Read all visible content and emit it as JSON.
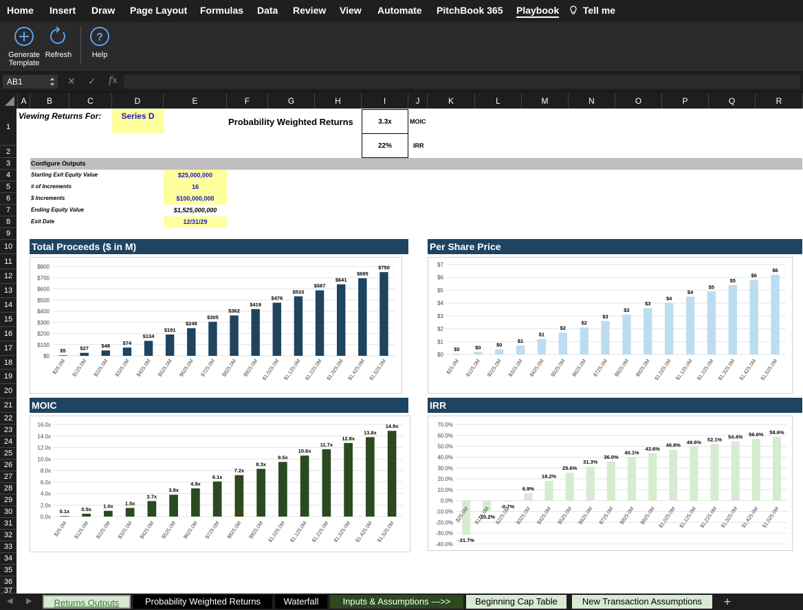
{
  "menu": [
    "Home",
    "Insert",
    "Draw",
    "Page Layout",
    "Formulas",
    "Data",
    "Review",
    "View",
    "Automate",
    "PitchBook 365",
    "Playbook",
    "Tell me"
  ],
  "ribbon": {
    "generate": "Generate Template",
    "refresh": "Refresh",
    "help": "Help"
  },
  "formula_bar": {
    "name_box": "AB1",
    "fx": "fx",
    "formula": ""
  },
  "columns": [
    "A",
    "B",
    "C",
    "D",
    "E",
    "F",
    "G",
    "H",
    "I",
    "J",
    "K",
    "L",
    "M",
    "N",
    "O",
    "P",
    "Q",
    "R"
  ],
  "rows": [
    "1",
    "2",
    "3",
    "4",
    "5",
    "6",
    "7",
    "8",
    "9",
    "10",
    "11",
    "12",
    "13",
    "14",
    "15",
    "16",
    "17",
    "18",
    "19",
    "20",
    "21",
    "22",
    "23",
    "24",
    "25",
    "26",
    "27",
    "28",
    "29",
    "30",
    "31",
    "32",
    "33",
    "34",
    "35",
    "36",
    "37"
  ],
  "sheet": {
    "viewing_label": "Viewing Returns For:",
    "series": "Series D",
    "pwr_label": "Probability Weighted Returns",
    "moic_value": "3.3x",
    "moic_label": "MOIC",
    "irr_value": "22%",
    "irr_label": "IRR",
    "configure": "Configure Outputs",
    "start_label": "Starting Exit Equity Value",
    "start_value": "$25,000,000",
    "incr_label": "# of Increments",
    "incr_value": "16",
    "dincr_label": "$ Increments",
    "dincr_value": "$100,000,000",
    "end_label": "Ending Equity Value",
    "end_value": "$1,525,000,000",
    "exit_label": "Exit Date",
    "exit_value": "12/31/29"
  },
  "chart_data": [
    {
      "type": "bar",
      "title": "Total Proceeds ($ in M)",
      "color": "#1e4460",
      "categories": [
        "$25.0M",
        "$125.0M",
        "$225.0M",
        "$325.0M",
        "$425.0M",
        "$525.0M",
        "$625.0M",
        "$725.0M",
        "$825.0M",
        "$925.0M",
        "$1,025.0M",
        "$1,125.0M",
        "$1,225.0M",
        "$1,325.0M",
        "$1,425.0M",
        "$1,525.0M"
      ],
      "values": [
        5,
        27,
        48,
        74,
        134,
        191,
        248,
        305,
        362,
        419,
        476,
        533,
        587,
        641,
        695,
        750
      ],
      "labels": [
        "$5",
        "$27",
        "$48",
        "$74",
        "$134",
        "$191",
        "$248",
        "$305",
        "$362",
        "$419",
        "$476",
        "$533",
        "$587",
        "$641",
        "$695",
        "$750"
      ],
      "yticks": [
        "$0",
        "$100",
        "$200",
        "$300",
        "$400",
        "$500",
        "$600",
        "$700",
        "$800"
      ],
      "ylim": [
        0,
        800
      ]
    },
    {
      "type": "bar",
      "title": "Per Share Price",
      "color": "#bcdcf2",
      "categories": [
        "$25.0M",
        "$125.0M",
        "$225.0M",
        "$325.0M",
        "$425.0M",
        "$525.0M",
        "$625.0M",
        "$725.0M",
        "$825.0M",
        "$925.0M",
        "$1,025.0M",
        "$1,125.0M",
        "$1,225.0M",
        "$1,325.0M",
        "$1,425.0M",
        "$1,525.0M"
      ],
      "values": [
        0.05,
        0.2,
        0.4,
        0.7,
        1.2,
        1.7,
        2.1,
        2.6,
        3.1,
        3.6,
        4.0,
        4.5,
        4.9,
        5.4,
        5.8,
        6.2
      ],
      "labels": [
        "$0",
        "$0",
        "$0",
        "$1",
        "$1",
        "$2",
        "$2",
        "$3",
        "$3",
        "$3",
        "$4",
        "$4",
        "$5",
        "$5",
        "$6",
        "$6"
      ],
      "yticks": [
        "$0",
        "$1",
        "$2",
        "$3",
        "$4",
        "$5",
        "$6",
        "$7"
      ],
      "ylim": [
        0,
        7
      ]
    },
    {
      "type": "bar",
      "title": "MOIC",
      "color": "#2b4a1f",
      "categories": [
        "$25.0M",
        "$125.0M",
        "$225.0M",
        "$325.0M",
        "$425.0M",
        "$525.0M",
        "$625.0M",
        "$725.0M",
        "$825.0M",
        "$925.0M",
        "$1,025.0M",
        "$1,125.0M",
        "$1,225.0M",
        "$1,325.0M",
        "$1,425.0M",
        "$1,525.0M"
      ],
      "values": [
        0.1,
        0.5,
        1.0,
        1.5,
        2.7,
        3.8,
        4.9,
        6.1,
        7.2,
        8.3,
        9.5,
        10.6,
        11.7,
        12.8,
        13.8,
        14.9
      ],
      "labels": [
        "0.1x",
        "0.5x",
        "1.0x",
        "1.5x",
        "2.7x",
        "3.8x",
        "4.9x",
        "6.1x",
        "7.2x",
        "8.3x",
        "9.5x",
        "10.6x",
        "11.7x",
        "12.8x",
        "13.8x",
        "14.9x"
      ],
      "yticks": [
        "0.0x",
        "2.0x",
        "4.0x",
        "6.0x",
        "8.0x",
        "10.0x",
        "12.0x",
        "14.0x",
        "16.0x"
      ],
      "ylim": [
        0,
        16
      ]
    },
    {
      "type": "bar",
      "title": "IRR",
      "color": "#d6ecd0",
      "categories": [
        "$25.0M",
        "$125.0M",
        "$225.0M",
        "$325.0M",
        "$425.0M",
        "$525.0M",
        "$625.0M",
        "$725.0M",
        "$825.0M",
        "$925.0M",
        "$1,025.0M",
        "$1,125.0M",
        "$1,225.0M",
        "$1,325.0M",
        "$1,425.0M",
        "$1,525.0M"
      ],
      "values": [
        -31.7,
        -10.2,
        -0.7,
        6.9,
        18.2,
        25.6,
        31.3,
        36.0,
        40.1,
        43.6,
        46.8,
        49.6,
        52.1,
        54.4,
        56.6,
        58.6
      ],
      "labels": [
        "-31.7%",
        "-10.2%",
        "-0.7%",
        "6.9%",
        "18.2%",
        "25.6%",
        "31.3%",
        "36.0%",
        "40.1%",
        "43.6%",
        "46.8%",
        "49.6%",
        "52.1%",
        "54.4%",
        "56.6%",
        "58.6%"
      ],
      "yticks": [
        "-40.0%",
        "-30.0%",
        "-20.0%",
        "-10.0%",
        "0.0%",
        "10.0%",
        "20.0%",
        "30.0%",
        "40.0%",
        "50.0%",
        "60.0%",
        "70.0%"
      ],
      "ylim": [
        -40,
        70
      ]
    }
  ],
  "tabs": [
    "Returns Outputs",
    "Probability Weighted Returns",
    "Waterfall",
    "Inputs & Assumptions --->>",
    "Beginning Cap Table",
    "New Transaction Assumptions",
    "+"
  ]
}
